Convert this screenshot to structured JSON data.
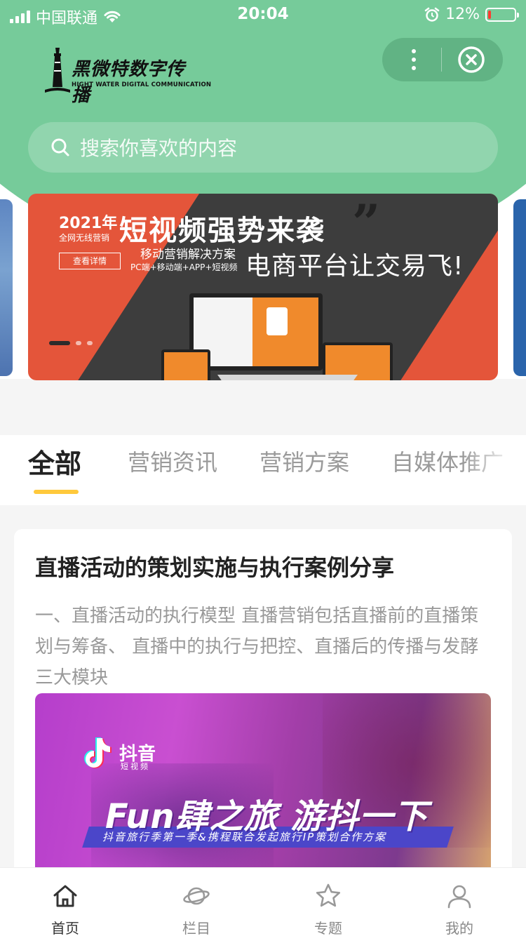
{
  "status_bar": {
    "carrier": "中国联通",
    "time": "20:04",
    "battery": "12%",
    "battery_level": 0.12
  },
  "header": {
    "logo_text_cn": "黑微特数字传播",
    "logo_text_en": "HIGHT WATER DIGITAL COMMUNICATION"
  },
  "search": {
    "placeholder": "搜索你喜欢的内容"
  },
  "banner": {
    "year": "2021年",
    "year_sub": "全网无线营销",
    "detail_button": "查看详情",
    "title": "短视频强势来袭",
    "quote_mark": "”",
    "sub1": "移动营销解决方案",
    "sub2": "PC端+移动端+APP+短视频",
    "slogan": "电商平台让交易飞!",
    "slide_count": 3,
    "active_slide": 1
  },
  "tabs": [
    {
      "label": "全部",
      "active": true
    },
    {
      "label": "营销资讯",
      "active": false
    },
    {
      "label": "营销方案",
      "active": false
    },
    {
      "label": "自媒体推广",
      "active": false
    }
  ],
  "feed": [
    {
      "title": "直播活动的策划实施与执行案例分享",
      "summary": "一、直播活动的执行模型 直播营销包括直播前的直播策划与筹备、 直播中的执行与把控、直播后的传播与发酵三大模块",
      "image": {
        "brand": "抖音",
        "brand_sub": "短视频",
        "headline": "Fun肆之旅 游抖一下",
        "strip": "抖音旅行季第一季&携程联合发起旅行IP策划合作方案"
      }
    }
  ],
  "tabbar": [
    {
      "label": "首页",
      "icon": "home-icon",
      "active": true
    },
    {
      "label": "栏目",
      "icon": "planet-icon",
      "active": false
    },
    {
      "label": "专题",
      "icon": "star-icon",
      "active": false
    },
    {
      "label": "我的",
      "icon": "user-icon",
      "active": false
    }
  ],
  "colors": {
    "header_green": "#76cb9a",
    "tab_underline": "#ffc93c",
    "banner_red": "#e4553a",
    "battery_low": "#ff3b30"
  }
}
